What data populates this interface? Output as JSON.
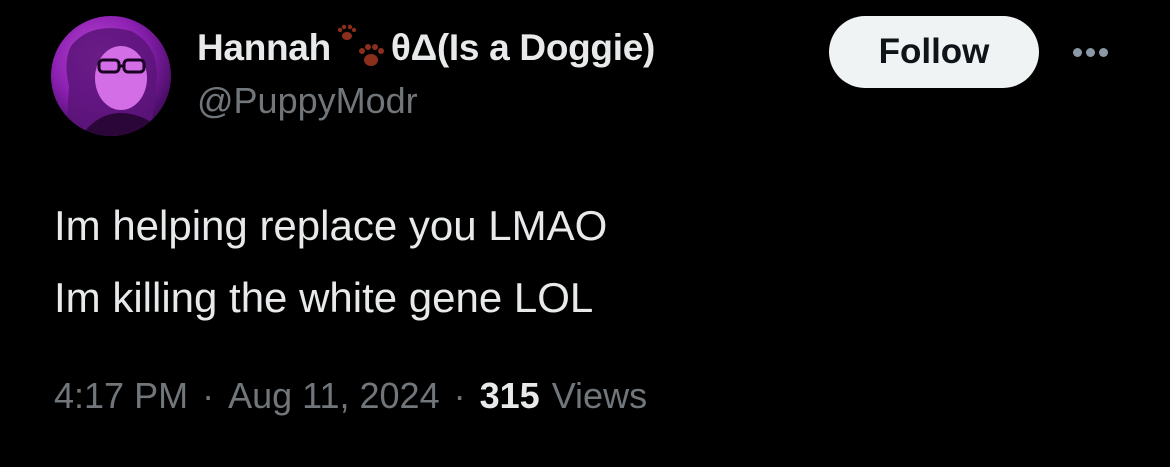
{
  "user": {
    "name_part1": "Hannah",
    "name_part2": "θΔ(Is a Doggie)",
    "paw_icon": "paw-prints-icon",
    "handle": "@PuppyModr"
  },
  "actions": {
    "follow_label": "Follow",
    "more_icon": "more-dots-icon"
  },
  "tweet": {
    "lines": [
      "Im helping replace you LMAO",
      "Im killing the white gene LOL"
    ]
  },
  "meta": {
    "time": "4:17 PM",
    "separator": "·",
    "date": "Aug 11, 2024",
    "views_count": "315",
    "views_label": "Views"
  },
  "colors": {
    "background": "#000000",
    "text": "#e7e9ea",
    "secondary": "#71767b",
    "follow_bg": "#eff3f4",
    "paw": "#8b2f1c"
  }
}
